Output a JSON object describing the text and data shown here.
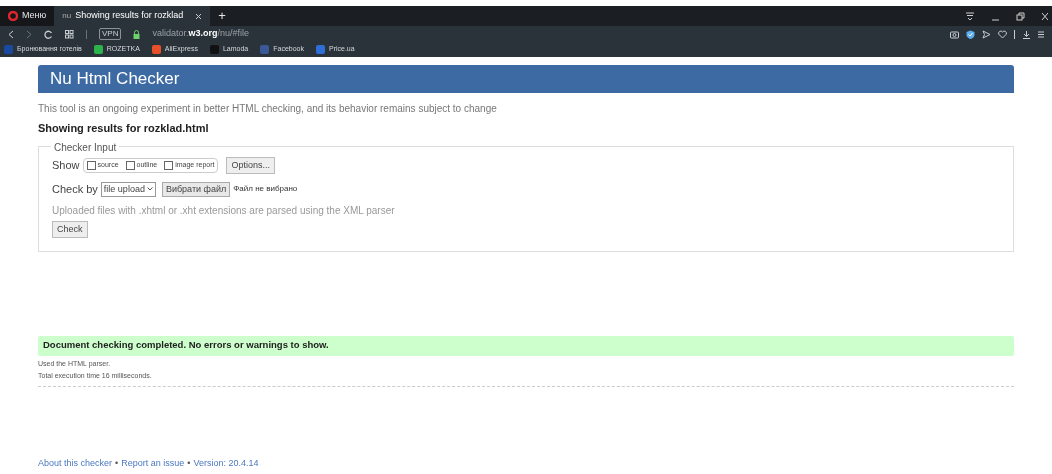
{
  "browser": {
    "menu_label": "Меню",
    "tabs": [
      {
        "favicon": "nu",
        "title": "Showing results for rozklad",
        "selected": true
      }
    ],
    "new_tab": "+",
    "address": {
      "host_prefix": "validator.",
      "host_main": "w3.org",
      "path": "/nu/#file"
    },
    "vpn_badge": "VPN"
  },
  "bookmarks": [
    {
      "label": "Бронювання готелів",
      "color": "#1a4aa0"
    },
    {
      "label": "ROZETKA",
      "color": "#2cb34a"
    },
    {
      "label": "AliExpress",
      "color": "#e8502a"
    },
    {
      "label": "Lamoda",
      "color": "#111111"
    },
    {
      "label": "Facebook",
      "color": "#3b5998"
    },
    {
      "label": "Price.ua",
      "color": "#2d6fd6"
    }
  ],
  "page": {
    "title": "Nu Html Checker",
    "intro": "This tool is an ongoing experiment in better HTML checking, and its behavior remains subject to change",
    "results_heading": "Showing results for rozklad.html",
    "checker_input": {
      "legend": "Checker Input",
      "show_label": "Show",
      "options": [
        {
          "label": "source",
          "checked": false
        },
        {
          "label": "outline",
          "checked": false
        },
        {
          "label": "image report",
          "checked": false
        }
      ],
      "options_button": "Options...",
      "check_by_label": "Check by",
      "check_by_value": "file upload",
      "choose_file_button": "Вибрати файл",
      "no_file": "Файл не вибрано",
      "note": "Uploaded files with .xhtml or .xht extensions are parsed using the XML parser",
      "check_button": "Check"
    },
    "success": "Document checking completed. No errors or warnings to show.",
    "details": [
      "Used the HTML parser.",
      "Total execution time 16 milliseconds."
    ],
    "footer": [
      {
        "kind": "link",
        "text": "About this checker"
      },
      {
        "kind": "sep",
        "text": "•"
      },
      {
        "kind": "link",
        "text": "Report an issue"
      },
      {
        "kind": "sep",
        "text": "•"
      },
      {
        "kind": "text",
        "text": "Version: 20.4.14"
      }
    ]
  }
}
